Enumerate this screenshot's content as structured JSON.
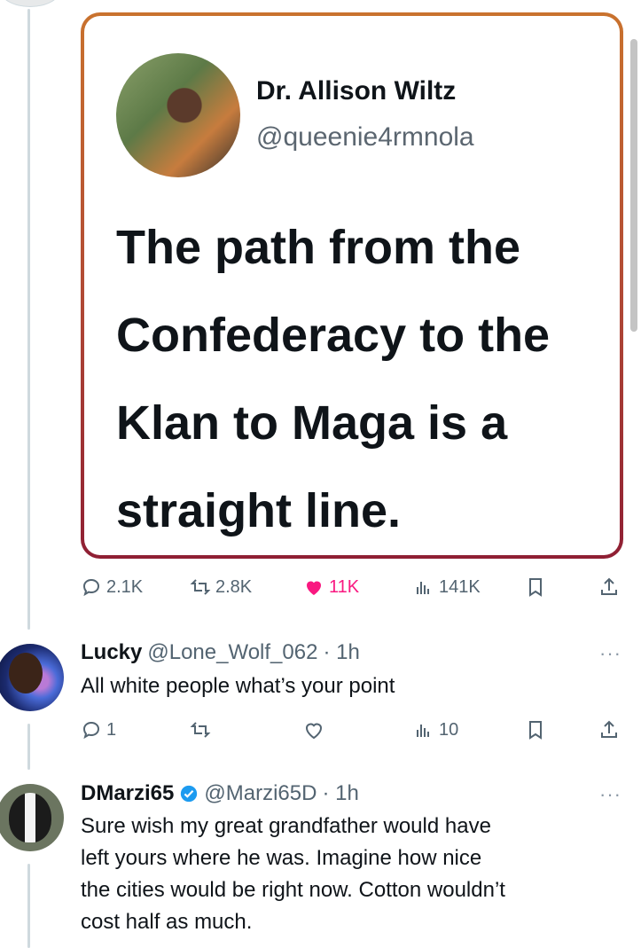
{
  "quote_card": {
    "name": "Dr. Allison Wiltz",
    "handle": "@queenie4rmnola",
    "quote": "The path from the Confederacy to the Klan to Maga is a straight line."
  },
  "main_tweet_metrics": {
    "replies": "2.1K",
    "retweets": "2.8K",
    "likes": "11K",
    "views": "141K"
  },
  "replies": [
    {
      "name": "Lucky",
      "handle": "@Lone_Wolf_062",
      "time": "· 1h",
      "text": "All white people what’s your point",
      "reply_count": "1",
      "views": "10"
    },
    {
      "name": "DMarzi65",
      "handle": "@Marzi65D",
      "time": "· 1h",
      "verified": true,
      "text_lines": [
        "Sure wish my great grandfather would have",
        "left yours where he was.  Imagine how nice",
        "the cities would be right now.  Cotton wouldn’t",
        "cost half as much."
      ]
    }
  ],
  "more_label": "···",
  "colors": {
    "like_pink": "#f91880",
    "verified_blue": "#1d9bf0",
    "muted": "#536471"
  }
}
